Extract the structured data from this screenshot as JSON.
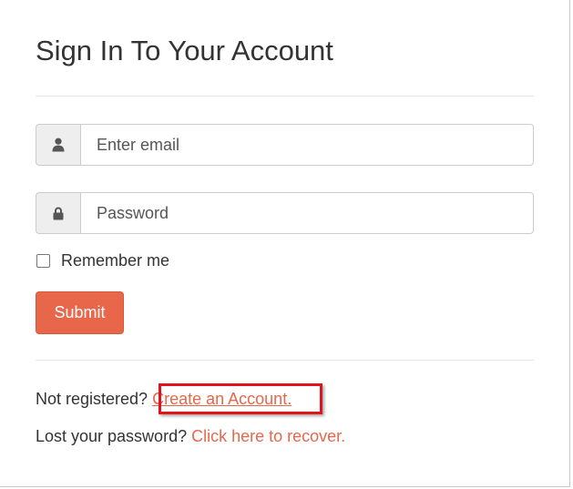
{
  "form": {
    "title": "Sign In To Your Account",
    "email": {
      "placeholder": "Enter email",
      "value": "",
      "icon": "user-icon"
    },
    "password": {
      "placeholder": "Password",
      "value": "",
      "icon": "lock-icon"
    },
    "remember_label": "Remember me",
    "remember_checked": false,
    "submit_label": "Submit"
  },
  "footer": {
    "not_registered_text": "Not registered?",
    "create_account_link": "Create an Account.",
    "lost_password_text": "Lost your password?",
    "recover_link": "Click here to recover."
  },
  "colors": {
    "accent": "#e8674b",
    "highlight_box": "#e2141b",
    "text": "#333333"
  }
}
